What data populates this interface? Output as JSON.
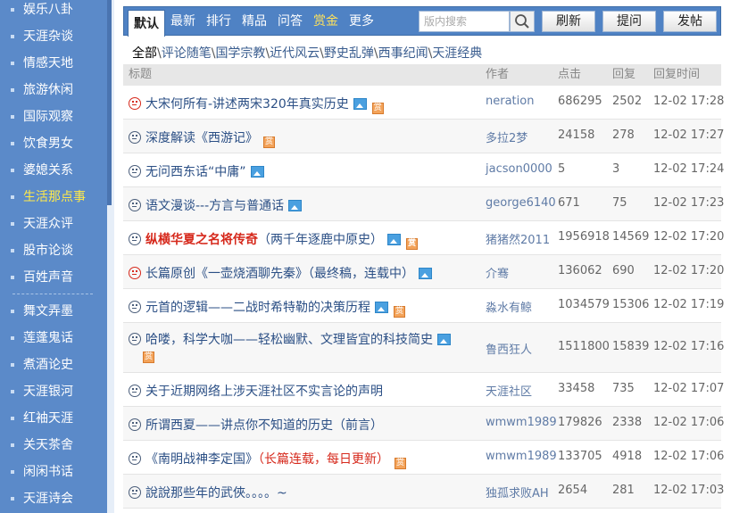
{
  "sidebar": {
    "items": [
      {
        "label": "娱乐八卦"
      },
      {
        "label": "天涯杂谈"
      },
      {
        "label": "情感天地"
      },
      {
        "label": "旅游休闲"
      },
      {
        "label": "国际观察"
      },
      {
        "label": "饮食男女"
      },
      {
        "label": "婆媳关系"
      },
      {
        "label": "生活那点事",
        "active": true
      },
      {
        "label": "天涯众评"
      },
      {
        "label": "股市论谈"
      },
      {
        "label": "百姓声音"
      },
      {
        "label": "舞文弄墨"
      },
      {
        "label": "莲蓬鬼话"
      },
      {
        "label": "煮酒论史"
      },
      {
        "label": "天涯银河"
      },
      {
        "label": "红袖天涯"
      },
      {
        "label": "关天茶舍"
      },
      {
        "label": "闲闲书话"
      },
      {
        "label": "天涯诗会"
      }
    ]
  },
  "toolbar": {
    "tabs": [
      "默认",
      "最新",
      "排行",
      "精品",
      "问答",
      "赏金",
      "更多"
    ],
    "search_placeholder": "版内搜索",
    "refresh_label": "刷新",
    "ask_label": "提问",
    "post_label": "发帖"
  },
  "categories": {
    "all": "全部",
    "items": [
      "评论随笔",
      "国学宗教",
      "近代风云",
      "野史乱弹",
      "西事纪闻",
      "天涯经典"
    ],
    "sep": "\\"
  },
  "table": {
    "headers": {
      "title": "标题",
      "author": "作者",
      "clicks": "点击",
      "replies": "回复",
      "reply_time": "回复时间"
    },
    "rows": [
      {
        "face": "red",
        "title": "大宋何所有-讲述两宋320年真实历史",
        "img": true,
        "badge": true,
        "author": "neration",
        "clicks": "686295",
        "replies": "2502",
        "time": "12-02 17:28"
      },
      {
        "face": "plain",
        "title": "深度解读《西游记》",
        "img": false,
        "badge": true,
        "author": "多拉2梦",
        "clicks": "24158",
        "replies": "278",
        "time": "12-02 17:27"
      },
      {
        "face": "plain",
        "title": "无问西东话“中庸”",
        "img": true,
        "badge": false,
        "author": "jacson0000",
        "clicks": "5",
        "replies": "3",
        "time": "12-02 17:24"
      },
      {
        "face": "plain",
        "title": "语文漫谈---方言与普通话",
        "img": true,
        "badge": false,
        "author": "george6140",
        "clicks": "671",
        "replies": "75",
        "time": "12-02 17:23"
      },
      {
        "face": "plain",
        "title": "纵横华夏之名将传奇",
        "title_suffix": "（两千年逐鹿中原史）",
        "style": "redbold",
        "img": true,
        "badge": true,
        "author": "猪猪然2011",
        "clicks": "1956918",
        "replies": "14569",
        "time": "12-02 17:20"
      },
      {
        "face": "red",
        "title": "长篇原创《一壶烧酒聊先秦》（最终稿，连载中）",
        "img": true,
        "badge": false,
        "author": "介骞",
        "clicks": "136062",
        "replies": "690",
        "time": "12-02 17:20"
      },
      {
        "face": "plain",
        "title": "元首的逻辑——二战时希特勒的决策历程",
        "img": true,
        "badge": true,
        "author": "淼水有鲸",
        "clicks": "1034579",
        "replies": "15306",
        "time": "12-02 17:19"
      },
      {
        "face": "plain",
        "title": "哈喽，科学大咖——轻松幽默、文理皆宜的科技简史",
        "img": true,
        "badge": true,
        "twoline": true,
        "author": "鲁西狂人",
        "clicks": "1511800",
        "replies": "15839",
        "time": "12-02 17:16"
      },
      {
        "face": "plain",
        "title": "关于近期网络上涉天涯社区不实言论的声明",
        "img": false,
        "badge": false,
        "author": "天涯社区",
        "clicks": "33458",
        "replies": "735",
        "time": "12-02 17:07"
      },
      {
        "face": "plain",
        "title": "所谓西夏——讲点你不知道的历史（前言）",
        "img": false,
        "badge": false,
        "author": "wmwm1989",
        "clicks": "179826",
        "replies": "2338",
        "time": "12-02 17:06"
      },
      {
        "face": "plain",
        "title": "《南明战神李定国》",
        "title_note": "（长篇连载，每日更新）",
        "img": false,
        "badge": true,
        "author": "wmwm1989",
        "clicks": "133705",
        "replies": "4918",
        "time": "12-02 17:06"
      },
      {
        "face": "plain",
        "title": "說說那些年的武俠。。。。~",
        "img": false,
        "badge": false,
        "author": "独孤求败AH",
        "clicks": "2654",
        "replies": "281",
        "time": "12-02 17:03"
      }
    ]
  }
}
